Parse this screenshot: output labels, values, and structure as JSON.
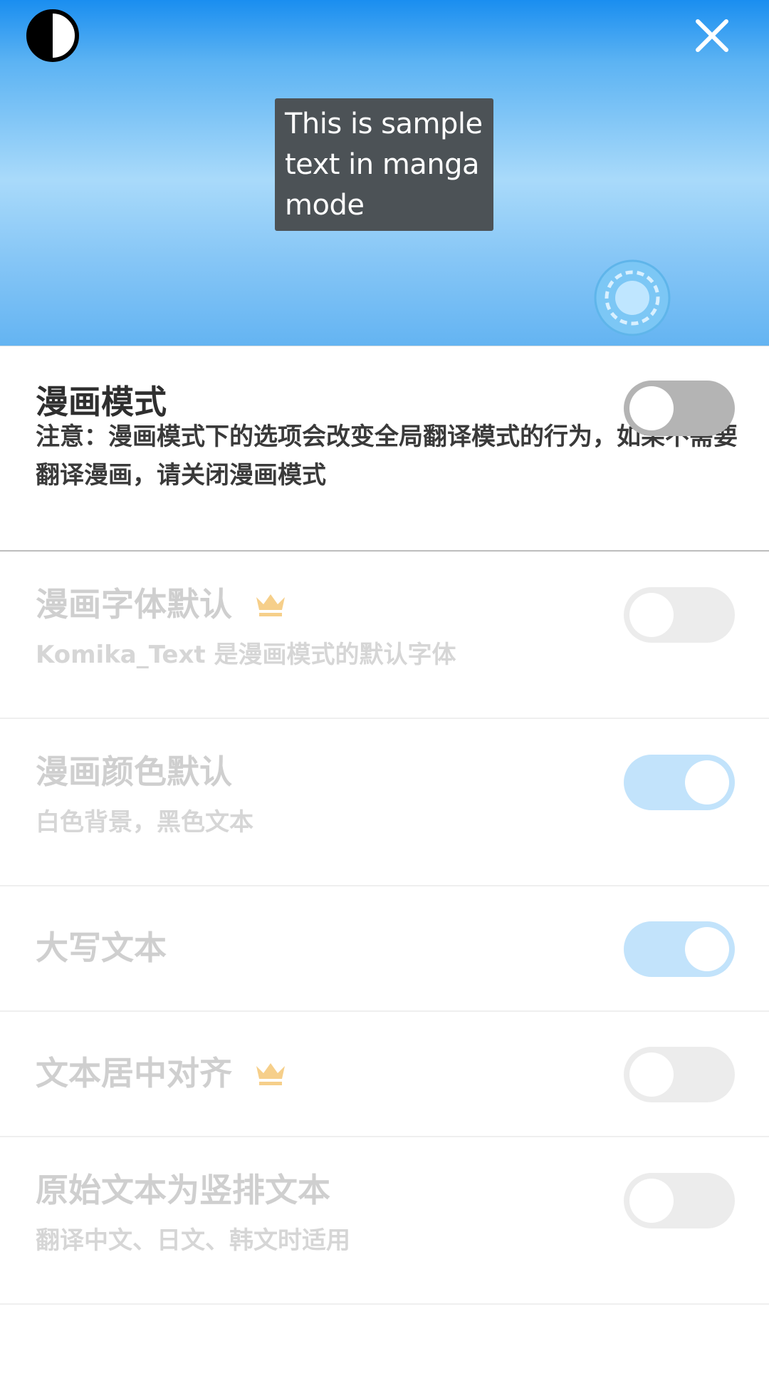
{
  "preview": {
    "sample_text": "This is sample text in manga mode",
    "background_gradient": [
      "#1a8ef0",
      "#a9dafa",
      "#64b4f2"
    ],
    "bubble_color": "#4c5256",
    "icons": {
      "contrast": "contrast-icon",
      "close": "close-icon",
      "floating": "floating-translate-button-icon"
    }
  },
  "master_setting": {
    "title": "漫画模式",
    "description": "注意：漫画模式下的选项会改变全局翻译模式的行为，如果不需要翻译漫画，请关闭漫画模式",
    "enabled": false
  },
  "settings": [
    {
      "title": "漫画字体默认",
      "premium": true,
      "description": "Komika_Text 是漫画模式的默认字体",
      "enabled": false
    },
    {
      "title": "漫画颜色默认",
      "premium": false,
      "description": "白色背景，黑色文本",
      "enabled": true
    },
    {
      "title": "大写文本",
      "premium": false,
      "description": "",
      "enabled": true
    },
    {
      "title": "文本居中对齐",
      "premium": true,
      "description": "",
      "enabled": false
    },
    {
      "title": "原始文本为竖排文本",
      "premium": false,
      "description": "翻译中文、日文、韩文时适用",
      "enabled": false
    }
  ],
  "colors": {
    "toggle_off_master": "#b4b4b4",
    "toggle_off_disabled": "#ececec",
    "toggle_on_disabled": "#c2e3fb",
    "crown": "#f6cf8a",
    "disabled_text": "#cfcfcf"
  }
}
